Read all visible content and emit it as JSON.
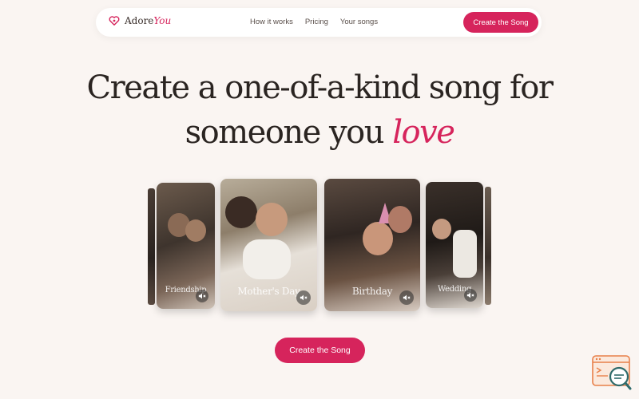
{
  "brand": {
    "name": "Adore",
    "accent": "You"
  },
  "nav": {
    "links": [
      "How it works",
      "Pricing",
      "Your songs"
    ],
    "cta": "Create the Song"
  },
  "hero": {
    "line1": "Create a one-of-a-kind song for",
    "line2_prefix": "someone you ",
    "line2_accent": "love"
  },
  "carousel": {
    "cards": [
      {
        "label": "Friendship"
      },
      {
        "label": "Mother's Day"
      },
      {
        "label": "Birthday"
      },
      {
        "label": "Wedding"
      }
    ],
    "mute_icon": "speaker-muted-icon"
  },
  "cta": {
    "label": "Create the Song"
  },
  "colors": {
    "accent": "#d6245c",
    "background": "#faf5f2",
    "text": "#2a2421"
  }
}
